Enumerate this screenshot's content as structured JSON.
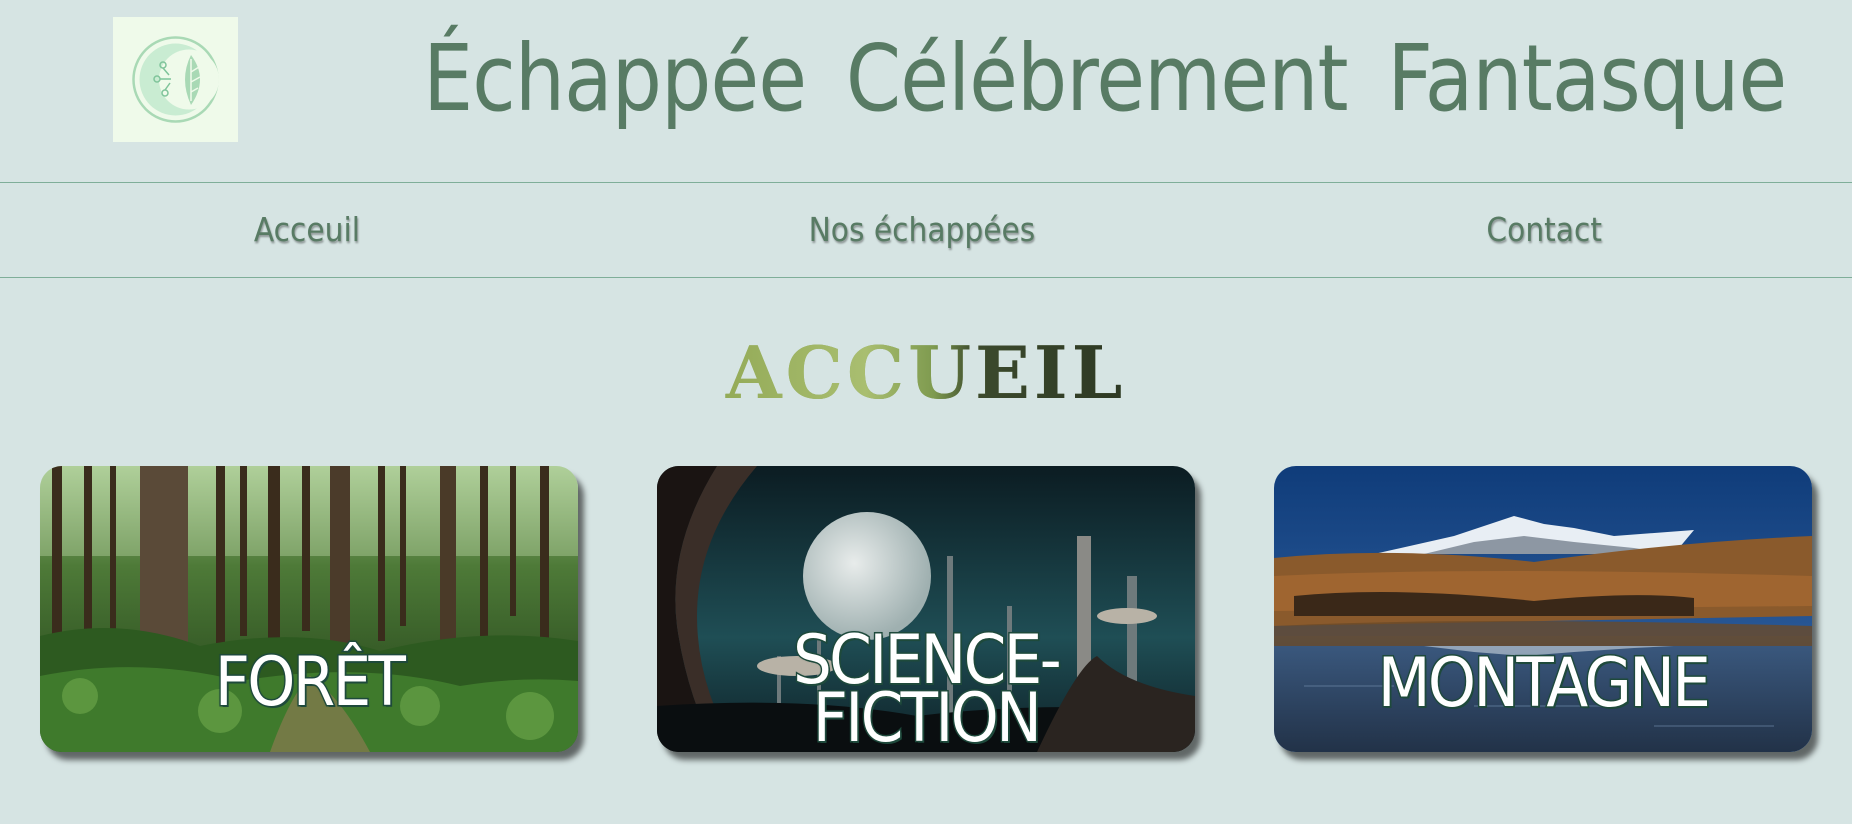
{
  "header": {
    "title": "Échappée Célébrement Fantasque",
    "logo_icon": "moon-leaf-circuit-logo"
  },
  "nav": {
    "items": [
      {
        "label": "Acceuil"
      },
      {
        "label": "Nos échappées"
      },
      {
        "label": "Contact"
      }
    ]
  },
  "main": {
    "heading": "ACCUEIL",
    "cards": [
      {
        "label": "FORÊT",
        "image": "forest-photo"
      },
      {
        "label": "SCIENCE-\nFICTION",
        "image": "scifi-moon-city-image"
      },
      {
        "label": "MONTAGNE",
        "image": "mountain-lake-photo"
      }
    ]
  },
  "colors": {
    "background": "#d6e4e3",
    "accent": "#587b64",
    "logo_bg": "#effaea",
    "divider": "#7fae99"
  }
}
